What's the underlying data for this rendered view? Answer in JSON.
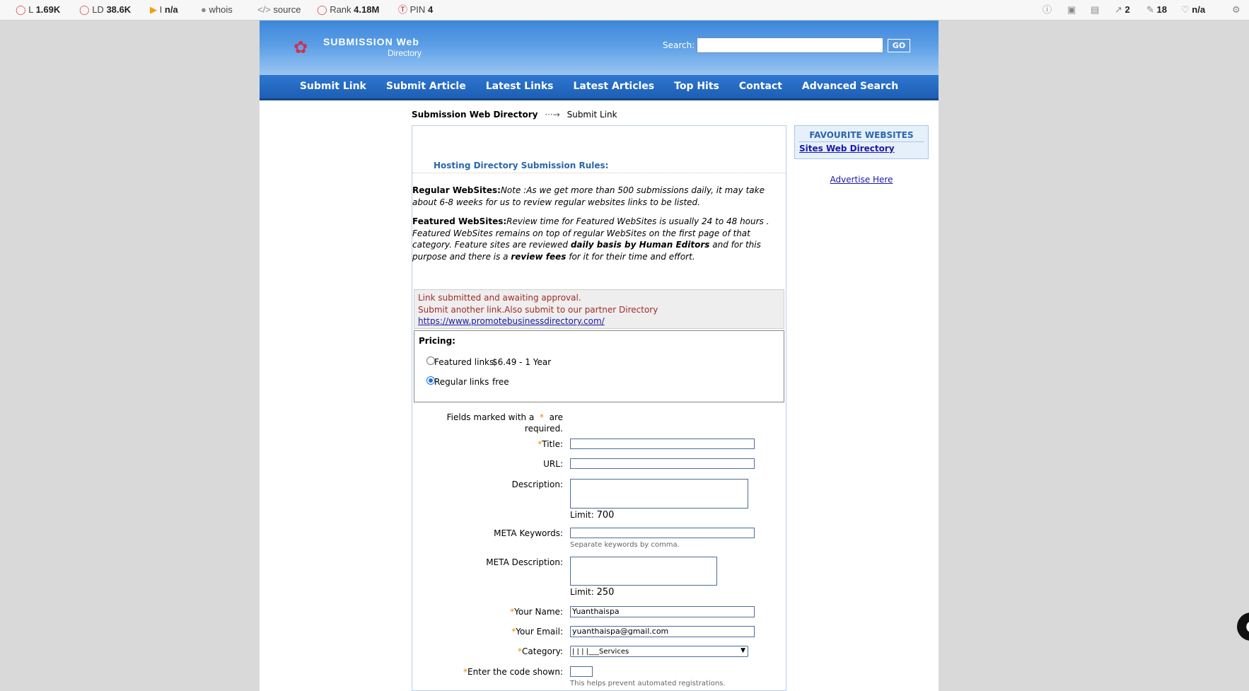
{
  "seo_bar": {
    "left_items": [
      {
        "icon": "circle-icon",
        "label": "L",
        "value": "1.69K"
      },
      {
        "icon": "circle-icon",
        "label": "LD",
        "value": "38.6K"
      },
      {
        "icon": "bing-icon",
        "label": "I",
        "value": "n/a"
      },
      {
        "icon": "person-icon",
        "label": "whois",
        "value": ""
      },
      {
        "icon": "code-icon",
        "label": "source",
        "value": ""
      },
      {
        "icon": "circle-icon",
        "label": "Rank",
        "value": "4.18M"
      },
      {
        "icon": "pinterest-icon",
        "label": "PIN",
        "value": "4"
      }
    ],
    "right_items": [
      {
        "icon": "info-icon",
        "value": ""
      },
      {
        "icon": "chat-icon",
        "value": ""
      },
      {
        "icon": "doc-icon",
        "value": ""
      },
      {
        "icon": "external-link-icon",
        "value": "2"
      },
      {
        "icon": "edit-icon",
        "value": "18"
      },
      {
        "icon": "heart-icon",
        "value": "n/a"
      },
      {
        "icon": "gear-icon",
        "value": ""
      }
    ]
  },
  "header": {
    "logo_main": "SUBMISSION Web",
    "logo_sub": "Directory",
    "search_label": "Search:",
    "search_value": "",
    "go_label": "GO"
  },
  "nav": [
    "Submit Link",
    "Submit Article",
    "Latest Links",
    "Latest Articles",
    "Top Hits",
    "Contact",
    "Advanced Search"
  ],
  "breadcrumb": {
    "home": "Submission Web Directory",
    "arrow": "···→",
    "current": "Submit Link"
  },
  "rules": {
    "title": "Hosting Directory Submission Rules:",
    "regular_label": "Regular WebSites:",
    "regular_text": "Note :As we get more than 500 submissions daily, it may take about 6-8 weeks for us to review regular websites links to be listed.",
    "featured_label": "Featured WebSites:",
    "featured_text_1": "Review time for Featured WebSites is usually 24 to 48 hours . Featured WebSites remains on top of regular WebSites on the first page of that category. Feature sites are reviewed ",
    "featured_bold_1": "daily basis by Human Editors",
    "featured_text_2": " and for this purpose and there is a ",
    "featured_bold_2": "review fees",
    "featured_text_3": " for it for their time and effort."
  },
  "notice": {
    "line1": "Link submitted and awaiting approval.",
    "line2": "Submit another link.Also submit to our partner Directory",
    "link": "https://www.promotebusinessdirectory.com/"
  },
  "pricing": {
    "title": "Pricing:",
    "options": [
      {
        "label": "Featured links",
        "price": "$6.49 - 1 Year",
        "selected": false
      },
      {
        "label": "Regular links",
        "price": "free",
        "selected": true
      }
    ]
  },
  "form": {
    "required_note_1": "Fields marked with a",
    "required_star": "*",
    "required_note_2": "are",
    "required_note_3": "required.",
    "title_label": "Title:",
    "title_value": "",
    "url_label": "URL:",
    "url_value": "",
    "description_label": "Description:",
    "description_value": "",
    "description_limit_label": "Limit:",
    "description_limit": "700",
    "meta_keywords_label": "META Keywords:",
    "meta_keywords_value": "",
    "meta_keywords_hint": "Separate keywords by comma.",
    "meta_description_label": "META Description:",
    "meta_description_value": "",
    "meta_description_limit_label": "Limit:",
    "meta_description_limit": "250",
    "name_label": "Your Name:",
    "name_value": "Yuanthaispa",
    "email_label": "Your Email:",
    "email_value": "yuanthaispa@gmail.com",
    "category_label": "Category:",
    "category_value": "|  |  |  |___Services",
    "code_label": "Enter the code shown:",
    "code_value": "",
    "code_hint": "This helps prevent automated registrations."
  },
  "sidebar": {
    "fav_title": "FAVOURITE WEBSITES",
    "fav_link": "Sites Web Directory",
    "advertise": "Advertise Here"
  },
  "colors": {
    "header_blue": "#3d86d8",
    "nav_blue": "#1d5fb4",
    "notice_red": "#a52a2a",
    "required_orange": "#e88a00",
    "link_blue": "#1a1aa6"
  }
}
